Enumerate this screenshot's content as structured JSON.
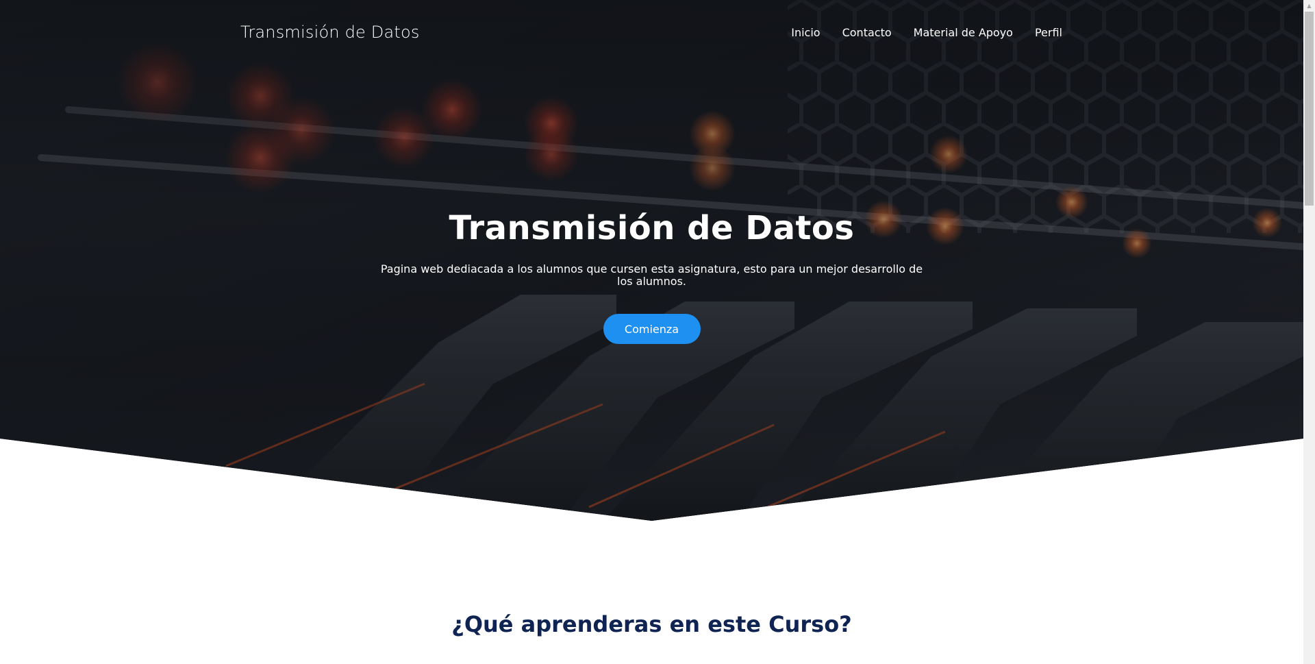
{
  "navbar": {
    "brand": "Transmisión de Datos",
    "links": [
      {
        "label": "Inicio"
      },
      {
        "label": "Contacto"
      },
      {
        "label": "Material de Apoyo"
      },
      {
        "label": "Perfil"
      }
    ]
  },
  "hero": {
    "title": "Transmisión de Datos",
    "subtitle": "Pagina web dediacada a los alumnos que cursen esta asignatura, esto para un mejor desarrollo de los alumnos.",
    "cta_label": "Comienza"
  },
  "section": {
    "title": "¿Qué aprenderas en este Curso?"
  },
  "colors": {
    "accent": "#1e90f2",
    "heading": "#0f2452",
    "hero_dark": "#14171c"
  }
}
